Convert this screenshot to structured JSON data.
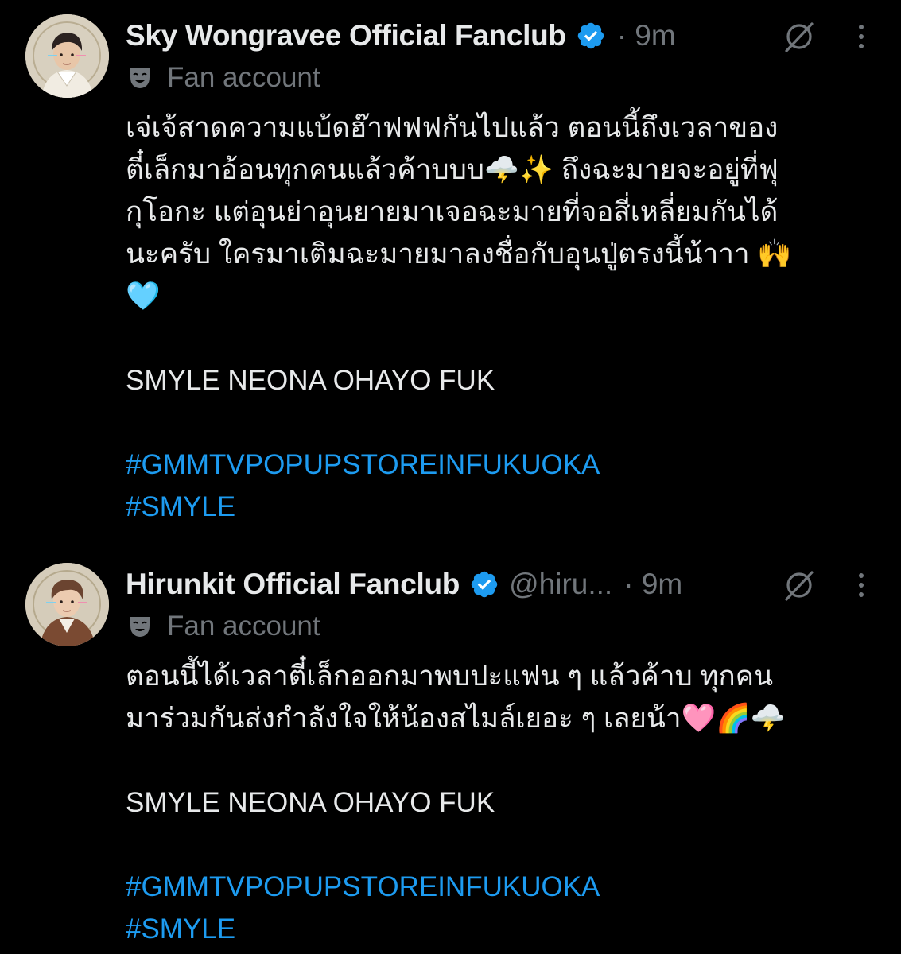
{
  "colors": {
    "background": "#000000",
    "text": "#e7e9ea",
    "muted": "#71767b",
    "link": "#1d9bf0",
    "verified": "#1d9bf0",
    "divider": "#2f3336"
  },
  "tweets": [
    {
      "display_name": "Sky Wongravee Official Fanclub",
      "handle": "",
      "time": "· 9m",
      "verified_icon": "verified-badge-icon",
      "label": "Fan account",
      "label_icon": "theater-mask-icon",
      "body_lines": [
        "เจ่เจ้สาดความแบ้ดฮ๊าฟฟฟกันไปแล้ว ตอนนี้ถึงเวลาของ",
        "ตี๋เล็กมาอ้อนทุกคนแล้วค้าบบบ🌩️✨ ถึงฉะมายจะอยู่ที่ฟุ",
        "กุโอกะ แต่อุนย่าอุนยายมาเจอฉะมายที่จอสี่เหลี่ยมกันได้",
        "นะครับ ใครมาเติมฉะมายมาลงชื่อกับอุนปู่ตรงนี้น้าาา 🙌",
        "🩵"
      ],
      "tagline": "SMYLE NEONA OHAYO FUK",
      "hashtags": [
        "#GMMTVPOPUPSTOREINFUKUOKA",
        "#SMYLE"
      ]
    },
    {
      "display_name": "Hirunkit Official Fanclub",
      "handle": "@hiru...",
      "time": "· 9m",
      "verified_icon": "verified-badge-icon",
      "label": "Fan account",
      "label_icon": "theater-mask-icon",
      "body_lines": [
        "ตอนนี้ได้เวลาตี๋เล็กออกมาพบปะแฟน ๆ แล้วค้าบ ทุกคน",
        "มาร่วมกันส่งกำลังใจให้น้องสไมล์เยอะ ๆ เลยน้า🩷🌈🌩️"
      ],
      "tagline": "SMYLE NEONA OHAYO FUK",
      "hashtags": [
        "#GMMTVPOPUPSTOREINFUKUOKA",
        "#SMYLE"
      ]
    }
  ]
}
